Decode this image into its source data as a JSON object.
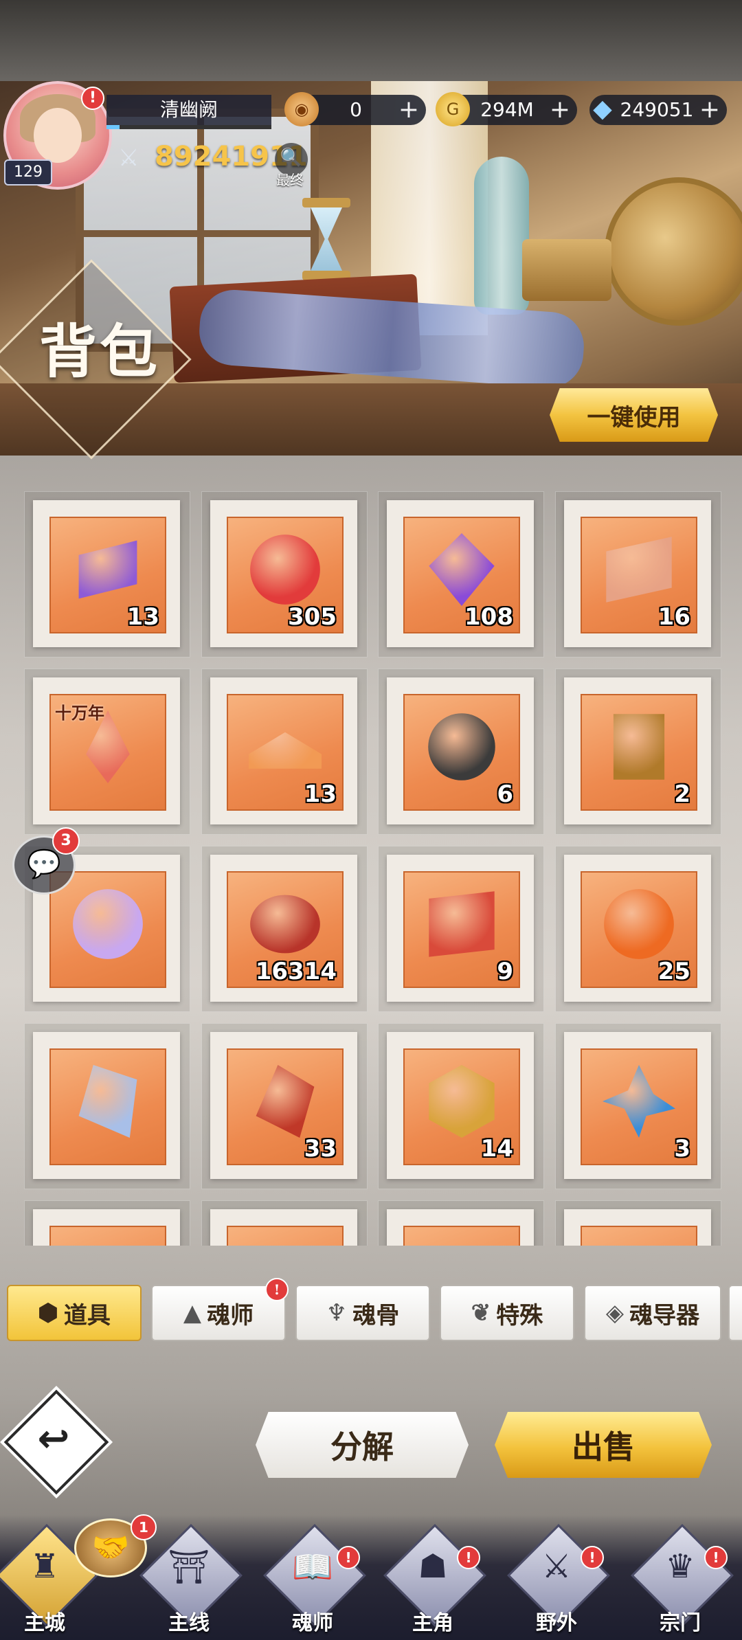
{
  "header": {
    "player_name": "清幽阙",
    "level": "129",
    "power": "89241911",
    "power_detail_label": "最终",
    "currencies": [
      {
        "icon": "gold-coin-icon",
        "value": "0"
      },
      {
        "icon": "gold-g-coin-icon",
        "value": "294M"
      },
      {
        "icon": "diamond-icon",
        "value": "249051"
      }
    ]
  },
  "banner": {
    "title": "背包",
    "use_all_label": "一键使用"
  },
  "items": [
    {
      "icon": "purple-scroll-icon",
      "count": "13",
      "color": "#8e5bd6",
      "tag": ""
    },
    {
      "icon": "red-demon-orb-icon",
      "count": "305",
      "color": "#e23b3b",
      "tag": ""
    },
    {
      "icon": "purple-crystal-icon",
      "count": "108",
      "color": "#8a4bd8",
      "tag": ""
    },
    {
      "icon": "red-scroll-icon",
      "count": "16",
      "color": "#e7a285",
      "tag": ""
    },
    {
      "icon": "red-crystal-shard-icon",
      "count": "",
      "color": "#e86a5a",
      "tag": "十万年"
    },
    {
      "icon": "open-book-icon",
      "count": "13",
      "color": "#f29a54",
      "tag": ""
    },
    {
      "icon": "star-coin-icon",
      "count": "6",
      "color": "#3b3b3b",
      "tag": ""
    },
    {
      "icon": "hammer-card-icon",
      "count": "2",
      "color": "#b07a2a",
      "tag": ""
    },
    {
      "icon": "purple-soul-orb-icon",
      "count": "",
      "color": "#c8a8f0",
      "tag": ""
    },
    {
      "icon": "eye-orb-icon",
      "count": "16314",
      "color": "#b8342a",
      "tag": ""
    },
    {
      "icon": "swirl-scroll-icon",
      "count": "9",
      "color": "#d94a3a",
      "tag": ""
    },
    {
      "icon": "fire-orb-icon",
      "count": "25",
      "color": "#ee6a22",
      "tag": ""
    },
    {
      "icon": "blue-crystal-icon",
      "count": "",
      "color": "#a8bfe8",
      "tag": ""
    },
    {
      "icon": "red-gem-icon",
      "count": "33",
      "color": "#c03828",
      "tag": ""
    },
    {
      "icon": "crown-badge-icon",
      "count": "14",
      "color": "#d8a33a",
      "tag": ""
    },
    {
      "icon": "blue-flower-icon",
      "count": "3",
      "color": "#3a8ed8",
      "tag": ""
    }
  ],
  "chat": {
    "badge": "3"
  },
  "tabs": [
    {
      "label": "道具",
      "icon": "cube-icon",
      "active": true,
      "alert": ""
    },
    {
      "label": "魂师",
      "icon": "soul-master-icon",
      "active": false,
      "alert": "!"
    },
    {
      "label": "魂骨",
      "icon": "soul-bone-icon",
      "active": false,
      "alert": ""
    },
    {
      "label": "特殊",
      "icon": "wing-icon",
      "active": false,
      "alert": ""
    },
    {
      "label": "魂导器",
      "icon": "gem-device-icon",
      "active": false,
      "alert": ""
    }
  ],
  "actions": {
    "decompose_label": "分解",
    "sell_label": "出售"
  },
  "handshake_badge": "1",
  "nav": [
    {
      "label": "主城",
      "icon": "castle-icon",
      "alert": ""
    },
    {
      "label": "主线",
      "icon": "gate-icon",
      "alert": ""
    },
    {
      "label": "魂师",
      "icon": "book-icon",
      "alert": "!"
    },
    {
      "label": "主角",
      "icon": "hooded-hero-icon",
      "alert": "!"
    },
    {
      "label": "野外",
      "icon": "sword-icon",
      "alert": "!"
    },
    {
      "label": "宗门",
      "icon": "sect-emblem-icon",
      "alert": "!"
    }
  ]
}
